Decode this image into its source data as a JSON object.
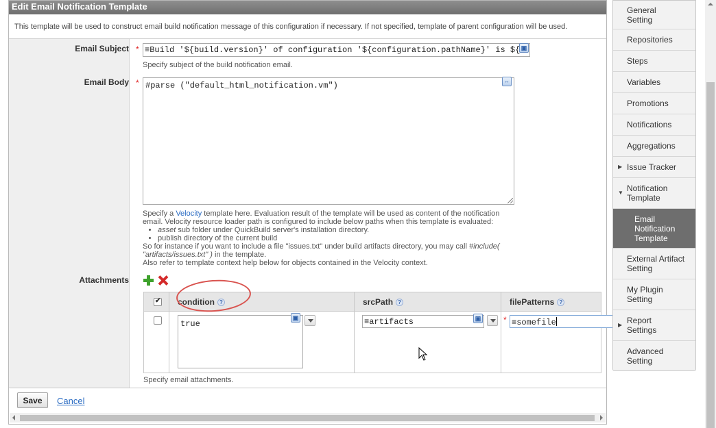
{
  "dialog": {
    "title": "Edit Email Notification Template",
    "description": "This template will be used to construct email build notification message of this configuration if necessary. If not specified, template of parent configuration will be used."
  },
  "form": {
    "subject_label": "Email Subject",
    "subject_value": "≡Build '${build.version}' of configuration '${configuration.pathName}' is ${",
    "subject_help": "Specify subject of the build notification email.",
    "body_label": "Email Body",
    "body_value": "#parse (\"default_html_notification.vm\")",
    "velocity": {
      "line1_prefix": "Specify a ",
      "link": "Velocity",
      "line1_suffix": " template here. Evaluation result of the template will be used as content of the notification email. Velocity resource loader path is configured to include below paths when this template is evaluated:",
      "bullet1_em": "asset",
      "bullet1_rest": " sub folder under QuickBuild server's installation directory.",
      "bullet2": "publish directory of the current build",
      "line2_prefix": "So for instance if you want to include a file \"issues.txt\" under build artifacts directory, you may call ",
      "line2_code": "#include( \"artifacts/issues.txt\" )",
      "line2_suffix": " in the template.",
      "line3": "Also refer to template context help below for objects contained in the Velocity context."
    },
    "attachments_label": "Attachments",
    "attachments_help": "Specify email attachments.",
    "required_mark": "*",
    "help_mark": "?",
    "table": {
      "columns": [
        "condition",
        "srcPath",
        "filePatterns"
      ],
      "rows": [
        {
          "condition": "true",
          "srcPath": "≡artifacts",
          "filePatterns": "≡somefile"
        }
      ]
    }
  },
  "footer": {
    "save_label": "Save",
    "cancel_label": "Cancel"
  },
  "sidebar": {
    "items": [
      {
        "label": "General Setting"
      },
      {
        "label": "Repositories"
      },
      {
        "label": "Steps"
      },
      {
        "label": "Variables"
      },
      {
        "label": "Promotions"
      },
      {
        "label": "Notifications"
      },
      {
        "label": "Aggregations"
      },
      {
        "label": "Issue Tracker"
      },
      {
        "label": "Notification Template"
      },
      {
        "label": "Email Notification Template"
      },
      {
        "label": "External Artifact Setting"
      },
      {
        "label": "My Plugin Setting"
      },
      {
        "label": "Report Settings"
      },
      {
        "label": "Advanced Setting"
      }
    ]
  },
  "colors": {
    "accent_link": "#2a6bc2",
    "required": "#e02020",
    "highlight_oval": "#d9534f",
    "selected_item": "#6e6e6e"
  }
}
